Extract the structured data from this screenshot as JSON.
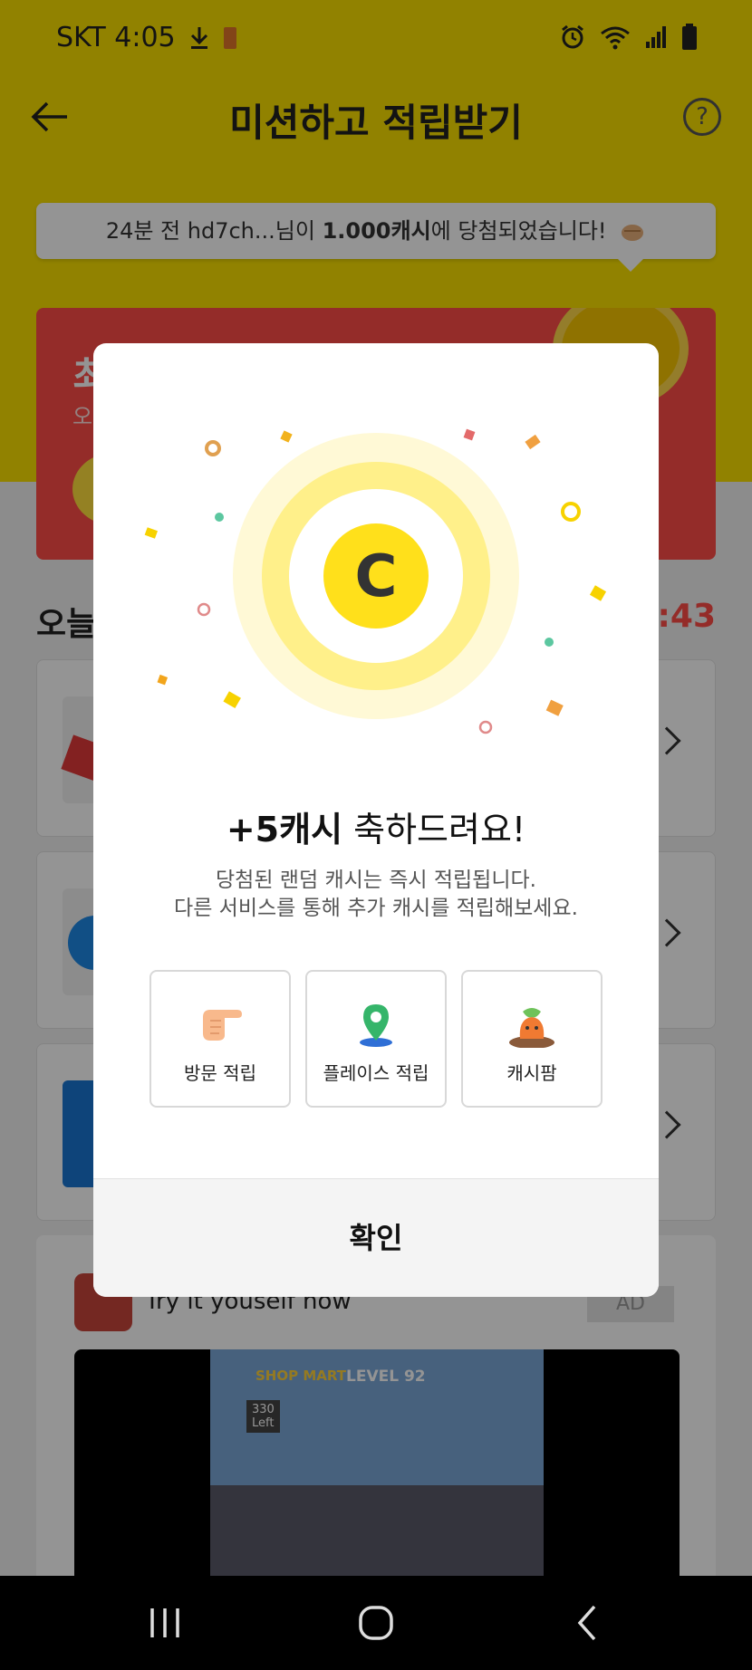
{
  "status_bar": {
    "carrier_time": "SKT 4:05"
  },
  "app_bar": {
    "title": "미션하고 적립받기",
    "help_glyph": "?"
  },
  "toast": {
    "prefix": "24분 전 hd7ch...님이 ",
    "amount": "1.000캐시",
    "suffix": "에 당첨되었습니다!"
  },
  "promo_banner": {
    "title_partial": "최",
    "subtitle_partial": "오"
  },
  "section": {
    "title_partial": "오늘",
    "timer_partial": "5:43"
  },
  "ad": {
    "title": "Try it youself now",
    "badge": "AD",
    "game": {
      "shop_label": "SHOP MART",
      "level": "LEVEL 92",
      "left_count": "330",
      "left_label": "Left"
    }
  },
  "modal": {
    "coin_letter": "C",
    "title_bold": "+5캐시",
    "title_rest": " 축하드려요!",
    "description_line1": "당첨된 랜덤 캐시는 즉시 적립됩니다.",
    "description_line2": "다른 서비스를 통해 추가 캐시를 적립해보세요.",
    "services": [
      {
        "label": "방문 적립",
        "icon": "pointing-hand-icon"
      },
      {
        "label": "플레이스 적립",
        "icon": "location-pin-icon"
      },
      {
        "label": "캐시팜",
        "icon": "carrot-character-icon"
      }
    ],
    "confirm_label": "확인"
  },
  "colors": {
    "brand_yellow": "#fae100",
    "coin_yellow": "#ffe01b",
    "banner_red": "#ff4d47",
    "timer_red": "#ff4d47"
  }
}
